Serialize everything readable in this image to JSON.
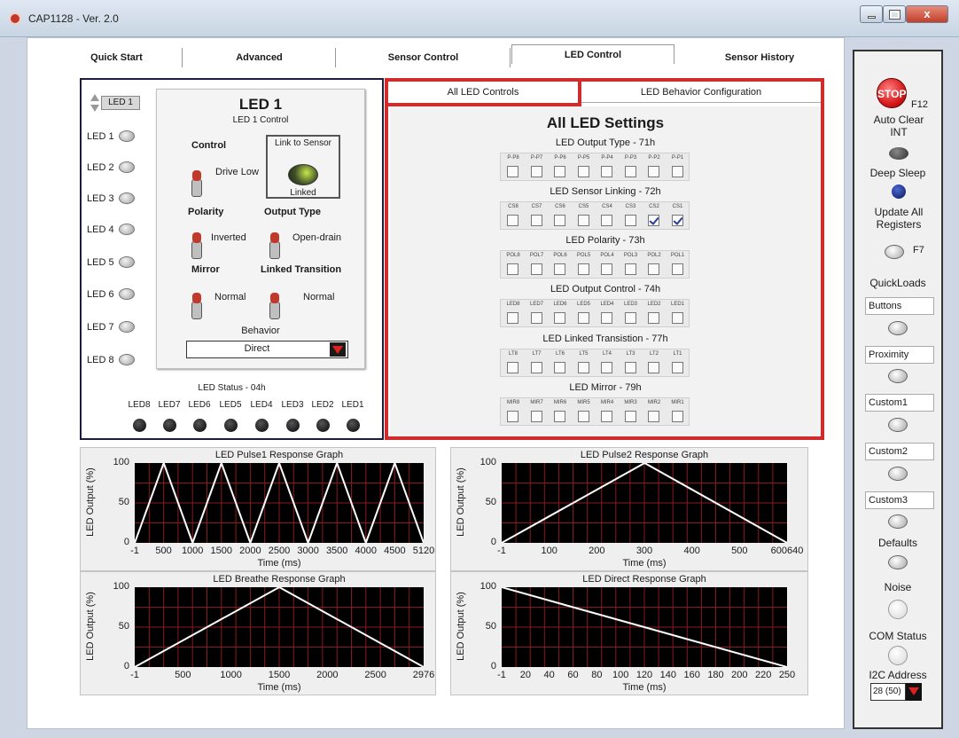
{
  "window": {
    "title": "CAP1128 - Ver. 2.0",
    "close_label": "x"
  },
  "tabs": [
    "Quick Start",
    "Advanced",
    "Sensor Control",
    "LED Control",
    "Sensor History"
  ],
  "led_panel": {
    "selector_value": "LED 1",
    "led_list": [
      "LED 1",
      "LED 2",
      "LED 3",
      "LED 4",
      "LED 5",
      "LED 6",
      "LED 7",
      "LED 8"
    ],
    "card_title": "LED 1",
    "card_subtitle": "LED 1 Control",
    "control_label": "Control",
    "control_value": "Drive Low",
    "link_label": "Link to Sensor",
    "link_value": "Linked",
    "polarity_label": "Polarity",
    "polarity_value": "Inverted",
    "output_type_label": "Output Type",
    "output_type_value": "Open-drain",
    "mirror_label": "Mirror",
    "mirror_value": "Normal",
    "linked_transition_label": "Linked Transition",
    "linked_transition_value": "Normal",
    "behavior_label": "Behavior",
    "behavior_value": "Direct",
    "status_label": "LED Status - 04h",
    "status_leds": [
      "LED8",
      "LED7",
      "LED6",
      "LED5",
      "LED4",
      "LED3",
      "LED2",
      "LED1"
    ]
  },
  "settings": {
    "tab_all": "All LED Controls",
    "tab_behavior": "LED Behavior Configuration",
    "heading": "All LED Settings",
    "groups": [
      {
        "title": "LED Output Type - 71h",
        "bits": [
          "P-P8",
          "P-P7",
          "P-P6",
          "P-P5",
          "P-P4",
          "P-P3",
          "P-P2",
          "P-P1"
        ],
        "checked": [
          false,
          false,
          false,
          false,
          false,
          false,
          false,
          false
        ]
      },
      {
        "title": "LED Sensor Linking - 72h",
        "bits": [
          "CS8",
          "CS7",
          "CS6",
          "CS5",
          "CS4",
          "CS3",
          "CS2",
          "CS1"
        ],
        "checked": [
          false,
          false,
          false,
          false,
          false,
          false,
          true,
          true
        ]
      },
      {
        "title": "LED Polarity - 73h",
        "bits": [
          "POL8",
          "POL7",
          "POL6",
          "POL5",
          "POL4",
          "POL3",
          "POL2",
          "POL1"
        ],
        "checked": [
          false,
          false,
          false,
          false,
          false,
          false,
          false,
          false
        ]
      },
      {
        "title": "LED Output Control - 74h",
        "bits": [
          "LED8",
          "LED7",
          "LED6",
          "LED5",
          "LED4",
          "LED3",
          "LED2",
          "LED1"
        ],
        "checked": [
          false,
          false,
          false,
          false,
          false,
          false,
          false,
          false
        ]
      },
      {
        "title": "LED Linked Transistion - 77h",
        "bits": [
          "LT8",
          "LT7",
          "LT6",
          "LT5",
          "LT4",
          "LT3",
          "LT2",
          "LT1"
        ],
        "checked": [
          false,
          false,
          false,
          false,
          false,
          false,
          false,
          false
        ]
      },
      {
        "title": "LED Mirror - 79h",
        "bits": [
          "MIR8",
          "MIR7",
          "MIR6",
          "MIR5",
          "MIR4",
          "MIR3",
          "MIR2",
          "MIR1"
        ],
        "checked": [
          false,
          false,
          false,
          false,
          false,
          false,
          false,
          false
        ]
      }
    ]
  },
  "chart_data": [
    {
      "type": "line",
      "title": "LED Pulse1 Response Graph",
      "xlabel": "Time (ms)",
      "ylabel": "LED Output (%)",
      "xticks": [
        "-1",
        "500",
        "1000",
        "1500",
        "2000",
        "2500",
        "3000",
        "3500",
        "4000",
        "4500",
        "5120"
      ],
      "yticks": [
        "0",
        "50",
        "100"
      ],
      "xlim": [
        -1,
        5120
      ],
      "ylim": [
        0,
        100
      ],
      "x": [
        -1,
        512,
        1024,
        1536,
        2048,
        2560,
        3072,
        3584,
        4096,
        4608,
        5120
      ],
      "y": [
        0,
        100,
        0,
        100,
        0,
        100,
        0,
        100,
        0,
        100,
        0
      ]
    },
    {
      "type": "line",
      "title": "LED Pulse2 Response Graph",
      "xlabel": "Time (ms)",
      "ylabel": "LED Output (%)",
      "xticks": [
        "-1",
        "100",
        "200",
        "300",
        "400",
        "500",
        "600640"
      ],
      "yticks": [
        "0",
        "50",
        "100"
      ],
      "xlim": [
        -1,
        640
      ],
      "ylim": [
        0,
        100
      ],
      "x": [
        -1,
        320,
        640
      ],
      "y": [
        0,
        100,
        0
      ]
    },
    {
      "type": "line",
      "title": "LED Breathe Response Graph",
      "xlabel": "Time (ms)",
      "ylabel": "LED Output (%)",
      "xticks": [
        "-1",
        "500",
        "1000",
        "1500",
        "2000",
        "2500",
        "2976"
      ],
      "yticks": [
        "0",
        "50",
        "100"
      ],
      "xlim": [
        -1,
        2976
      ],
      "ylim": [
        0,
        100
      ],
      "x": [
        -1,
        1488,
        2976
      ],
      "y": [
        0,
        100,
        0
      ]
    },
    {
      "type": "line",
      "title": "LED Direct Response Graph",
      "xlabel": "Time (ms)",
      "ylabel": "LED Output (%)",
      "xticks": [
        "-1",
        "20",
        "40",
        "60",
        "80",
        "100",
        "120",
        "140",
        "160",
        "180",
        "200",
        "220",
        "250"
      ],
      "yticks": [
        "0",
        "50",
        "100"
      ],
      "xlim": [
        -1,
        250
      ],
      "ylim": [
        0,
        100
      ],
      "x": [
        -1,
        250
      ],
      "y": [
        100,
        0
      ]
    }
  ],
  "side": {
    "stop_label": "STOP",
    "stop_key": "F12",
    "auto_clear_label": "Auto Clear INT",
    "deep_sleep_label": "Deep Sleep",
    "update_label": "Update All Registers",
    "update_key": "F7",
    "quickloads_label": "QuickLoads",
    "quickloads": [
      "Buttons",
      "Proximity",
      "Custom1",
      "Custom2",
      "Custom3"
    ],
    "defaults_label": "Defaults",
    "noise_label": "Noise",
    "com_label": "COM Status",
    "i2c_label": "I2C Address",
    "i2c_value": "28 (50)"
  },
  "colors": {
    "highlight_red": "#d02c2c",
    "plot_bg": "#000000",
    "grid_red": "#8b1a1a",
    "trace": "#ffffff"
  }
}
